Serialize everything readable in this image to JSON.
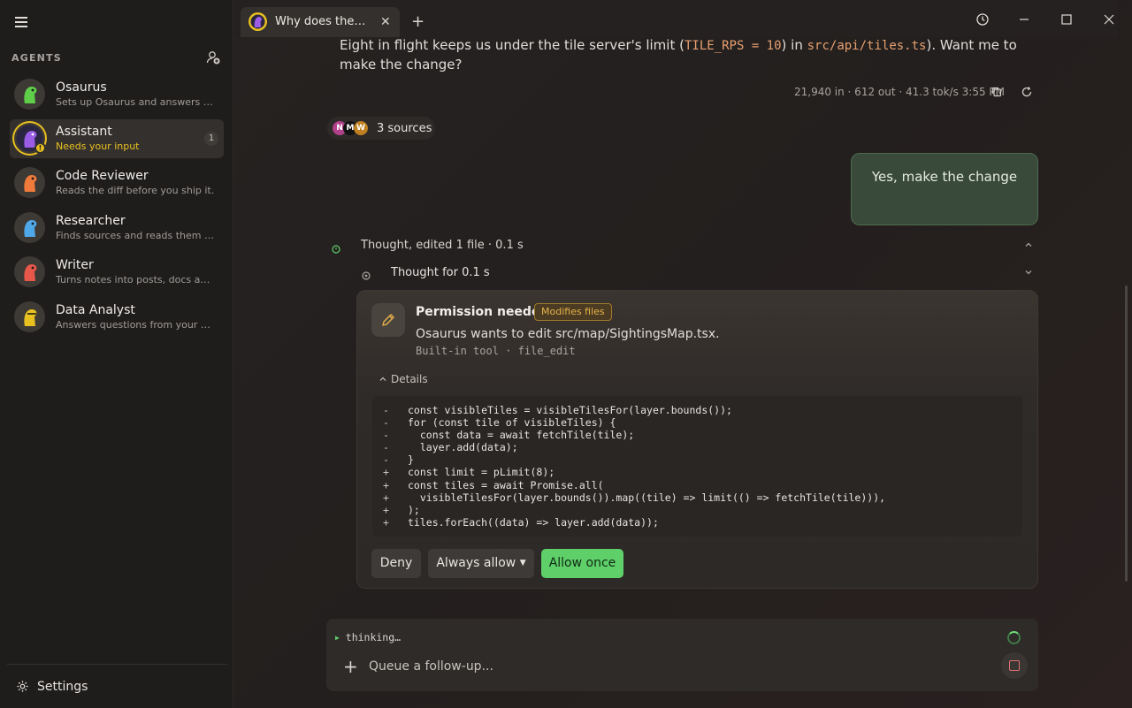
{
  "sidebar": {
    "section_label": "AGENTS",
    "agents": [
      {
        "name": "Osaurus",
        "desc": "Sets up Osaurus and answers qu...",
        "color": "#5fcf4a"
      },
      {
        "name": "Assistant",
        "desc": "Needs your input",
        "count": "1",
        "color": "#9b5de5"
      },
      {
        "name": "Code Reviewer",
        "desc": "Reads the diff before you ship it.",
        "color": "#f07a3a"
      },
      {
        "name": "Researcher",
        "desc": "Finds sources and reads them so...",
        "color": "#4fa8e8"
      },
      {
        "name": "Writer",
        "desc": "Turns notes into posts, docs and...",
        "color": "#e8584a"
      },
      {
        "name": "Data Analyst",
        "desc": "Answers questions from your CS...",
        "color": "#e8c020"
      }
    ],
    "settings_label": "Settings"
  },
  "tab": {
    "title": "Why does the si...",
    "close": "✕"
  },
  "chat": {
    "prev_text_start": "Eight in flight keeps us under the tile server's limit (",
    "prev_code1": "TILE_RPS = 10",
    "prev_text_mid": ") in ",
    "prev_code2": "src/api/tiles.ts",
    "prev_text_end": "). Want me to make the change?",
    "meta": "21,940 in · 612 out · 41.3 tok/s  3:55 PM",
    "sources_label": "3 sources",
    "source_initials": [
      "N",
      "M",
      "W"
    ],
    "user_message": "Yes, make the change",
    "thought_summary": "Thought, edited 1 file · 0.1 s",
    "thought_detail": "Thought for 0.1 s"
  },
  "permission": {
    "title": "Permission needed",
    "badge": "Modifies files",
    "text": "Osaurus wants to edit src/map/SightingsMap.tsx.",
    "sub": "Built-in tool · file_edit",
    "details_label": "Details",
    "diff": [
      {
        "mark": "-",
        "code": "const visibleTiles = visibleTilesFor(layer.bounds());"
      },
      {
        "mark": "-",
        "code": "for (const tile of visibleTiles) {"
      },
      {
        "mark": "-",
        "code": "  const data = await fetchTile(tile);"
      },
      {
        "mark": "-",
        "code": "  layer.add(data);"
      },
      {
        "mark": "-",
        "code": "}"
      },
      {
        "mark": "+",
        "code": "const limit = pLimit(8);"
      },
      {
        "mark": "+",
        "code": "const tiles = await Promise.all("
      },
      {
        "mark": "+",
        "code": "  visibleTilesFor(layer.bounds()).map((tile) => limit(() => fetchTile(tile))),"
      },
      {
        "mark": "+",
        "code": ");"
      },
      {
        "mark": "+",
        "code": "tiles.forEach((data) => layer.add(data));"
      }
    ],
    "deny": "Deny",
    "always_allow": "Always allow",
    "allow_once": "Allow once"
  },
  "composer": {
    "thinking": "thinking…",
    "placeholder": "Queue a follow-up..."
  },
  "colors": {
    "accent": "#5fcf6a",
    "warning": "#e8c020",
    "badge": "#e8b34a"
  }
}
